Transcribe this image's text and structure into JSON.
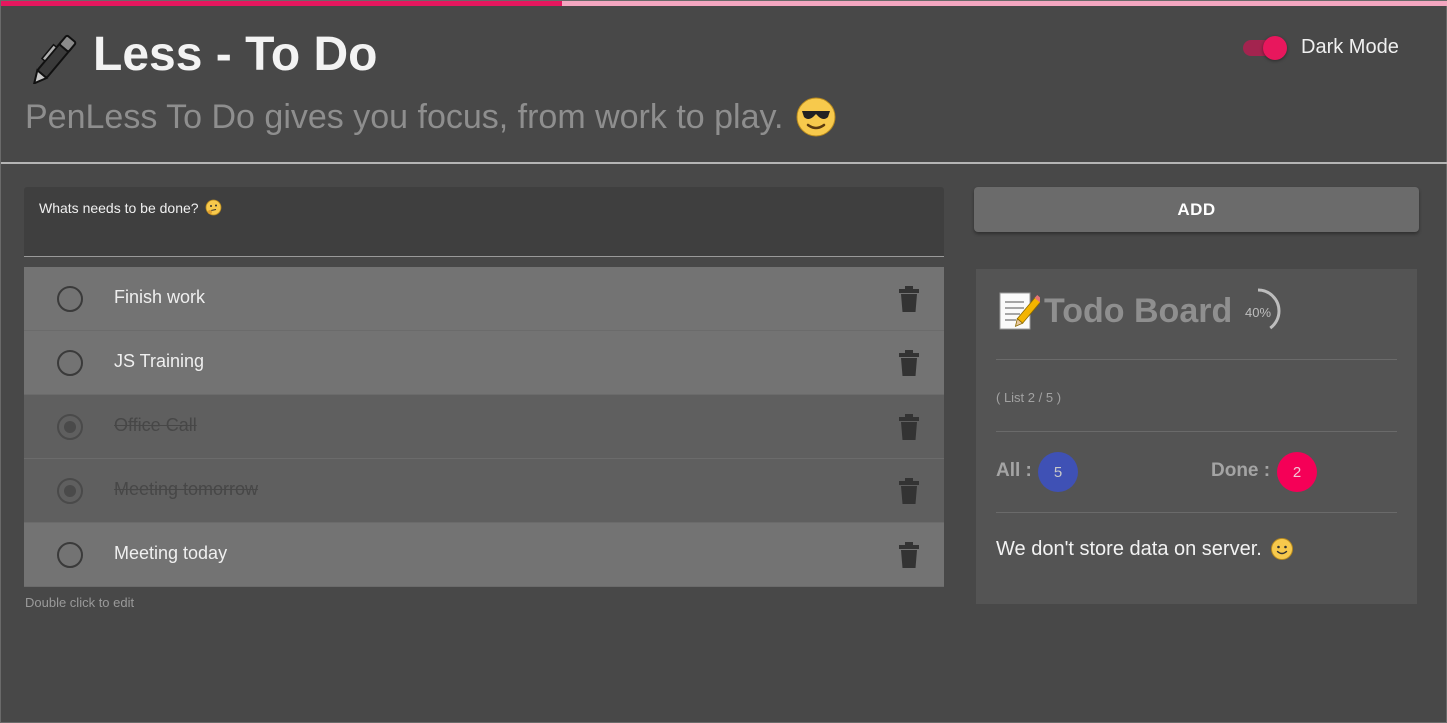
{
  "progress": {
    "fraction": 0.388,
    "fill_color": "#e5175e",
    "track_color": "#f3a6c0"
  },
  "header": {
    "title": "Less - To Do",
    "title_icon": "pen-icon",
    "subtitle": "PenLess To Do gives you focus, from work to play.",
    "subtitle_icon": "sunglasses-emoji-icon",
    "dark_mode_label": "Dark Mode",
    "dark_mode_on": true
  },
  "input": {
    "label": "Whats needs to be done?",
    "label_icon": "thinking-emoji-icon",
    "value": ""
  },
  "add_button": {
    "label": "ADD"
  },
  "todos": [
    {
      "text": "Finish work",
      "done": false
    },
    {
      "text": "JS Training",
      "done": false
    },
    {
      "text": "Office Call",
      "done": true
    },
    {
      "text": "Meeting tomorrow",
      "done": true
    },
    {
      "text": "Meeting today",
      "done": false
    }
  ],
  "hint": "Double click to edit",
  "board": {
    "title": "Todo Board",
    "title_icon": "memo-icon",
    "percent_label": "40%",
    "percent": 40,
    "list_count": "( List 2 / 5 )",
    "all_label": "All :",
    "all_value": "5",
    "done_label": "Done :",
    "done_value": "2",
    "note": "We don't store data on server.",
    "note_icon": "smile-emoji-icon",
    "colors": {
      "all_badge": "#3f51b5",
      "done_badge": "#f50057"
    }
  }
}
